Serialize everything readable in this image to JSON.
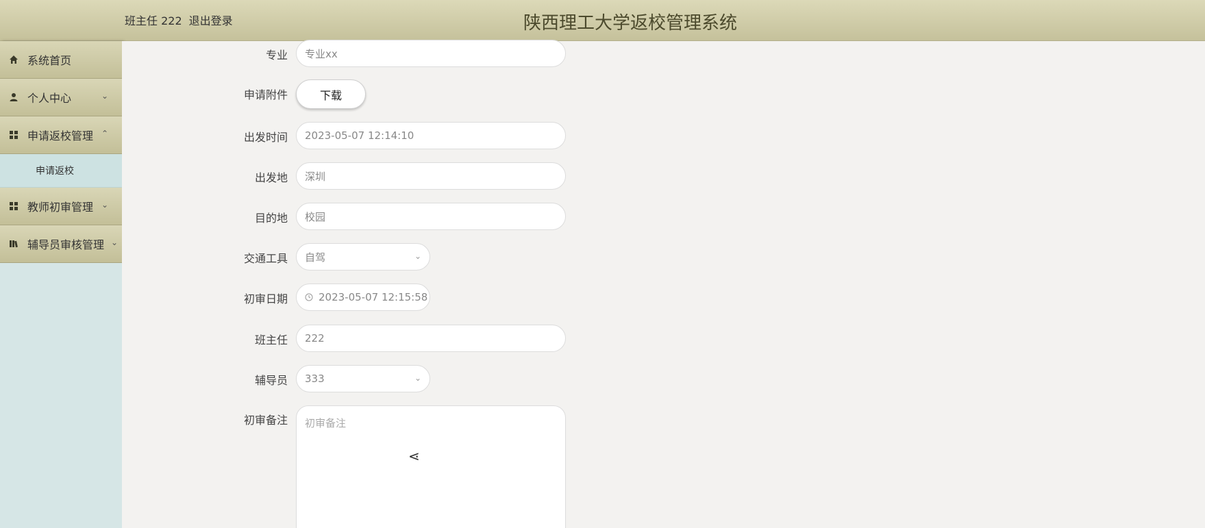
{
  "header": {
    "user": "班主任 222",
    "logout": "退出登录",
    "title": "陕西理工大学返校管理系统"
  },
  "sidebar": {
    "items": [
      {
        "label": "系统首页",
        "icon": "home-icon"
      },
      {
        "label": "个人中心",
        "icon": "user-icon",
        "chevron": "down"
      },
      {
        "label": "申请返校管理",
        "icon": "grid-icon",
        "chevron": "up"
      },
      {
        "label": "教师初审管理",
        "icon": "grid-icon",
        "chevron": "down"
      },
      {
        "label": "辅导员审核管理",
        "icon": "book-icon",
        "chevron": "down"
      }
    ],
    "subitems": [
      {
        "label": "申请返校"
      }
    ]
  },
  "form": {
    "major": {
      "label": "专业",
      "value": "专业xx"
    },
    "attachment": {
      "label": "申请附件",
      "button": "下载"
    },
    "depart_time": {
      "label": "出发时间",
      "value": "2023-05-07 12:14:10"
    },
    "depart_place": {
      "label": "出发地",
      "value": "深圳"
    },
    "destination": {
      "label": "目的地",
      "value": "校园"
    },
    "transport": {
      "label": "交通工具",
      "value": "自驾"
    },
    "review_date": {
      "label": "初审日期",
      "value": "2023-05-07 12:15:58"
    },
    "head_teacher": {
      "label": "班主任",
      "value": "222"
    },
    "counselor": {
      "label": "辅导员",
      "value": "333"
    },
    "review_note": {
      "label": "初审备注",
      "placeholder": "初审备注"
    }
  },
  "colors": {
    "header_bg": "#c5c19b",
    "sidebar_bg": "#d6e6e6",
    "title_color": "#4c4a2d"
  }
}
